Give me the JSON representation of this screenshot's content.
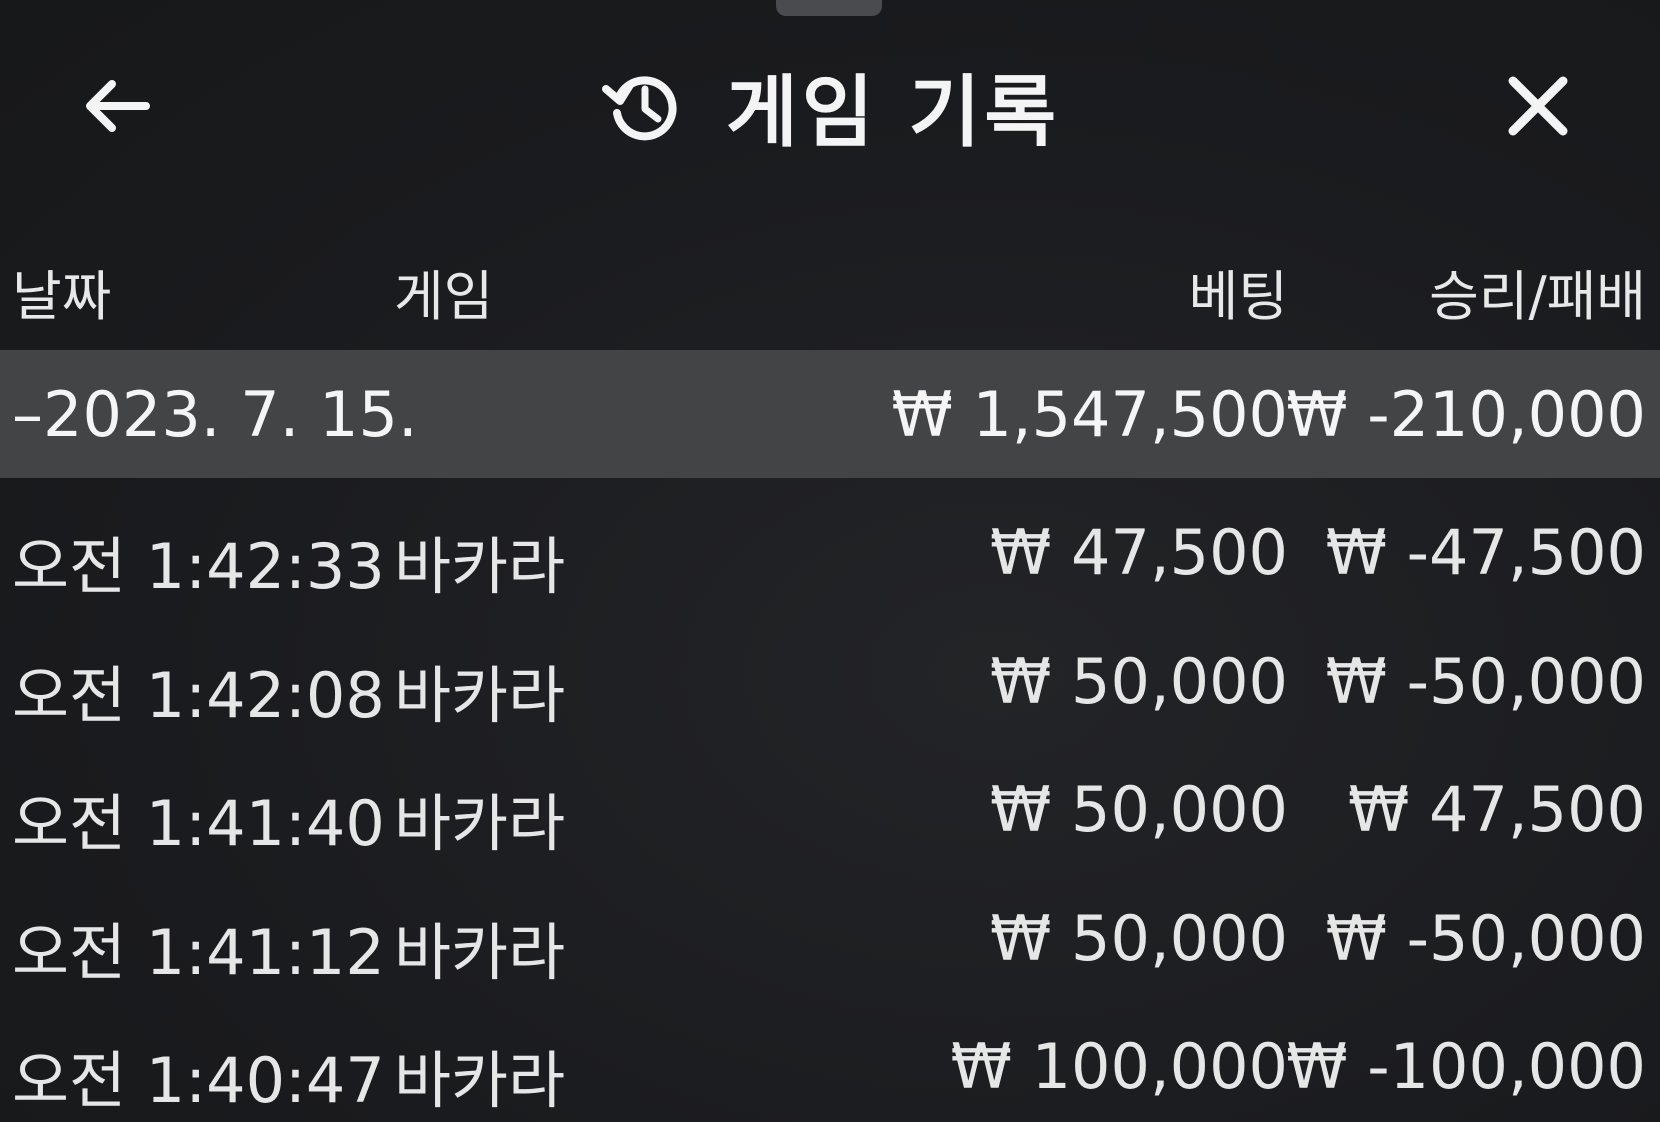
{
  "header": {
    "title": "게임 기록",
    "back_icon": "arrow-left-icon",
    "history_icon": "history-icon",
    "close_icon": "close-icon"
  },
  "columns": {
    "date": "날짜",
    "game": "게임",
    "bet": "베팅",
    "win_loss": "승리/패배"
  },
  "summary": {
    "date": "–2023. 7. 15.",
    "bet": "₩ 1,547,500",
    "win_loss": "₩ -210,000"
  },
  "rows": [
    {
      "time": "오전 1:42:33",
      "game": "바카라",
      "bet": "₩ 47,500",
      "win_loss": "₩ -47,500"
    },
    {
      "time": "오전 1:42:08",
      "game": "바카라",
      "bet": "₩ 50,000",
      "win_loss": "₩ -50,000"
    },
    {
      "time": "오전 1:41:40",
      "game": "바카라",
      "bet": "₩ 50,000",
      "win_loss": "₩ 47,500"
    },
    {
      "time": "오전 1:41:12",
      "game": "바카라",
      "bet": "₩ 50,000",
      "win_loss": "₩ -50,000"
    },
    {
      "time": "오전 1:40:47",
      "game": "바카라",
      "bet": "₩ 100,000",
      "win_loss": "₩ -100,000"
    }
  ]
}
